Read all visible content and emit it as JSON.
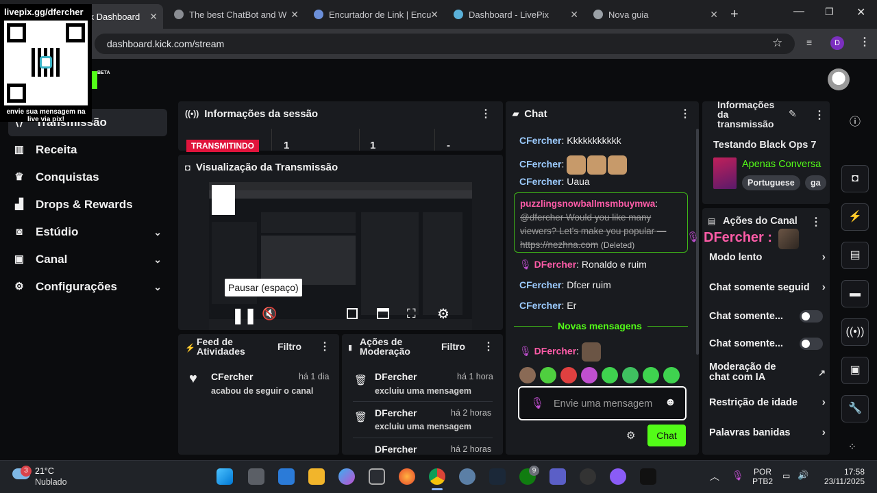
{
  "browser": {
    "tabs": [
      {
        "label": "ck Dashboard"
      },
      {
        "label": "The best ChatBot and W"
      },
      {
        "label": "Encurtador de Link | Encu"
      },
      {
        "label": "Dashboard - LivePix"
      },
      {
        "label": "Nova guia"
      }
    ],
    "url": "dashboard.kick.com/stream",
    "profile_initial": "D"
  },
  "overlay": {
    "title": "livepix.gg/dfercher",
    "caption": "envie sua mensagem na live via pix!"
  },
  "logo_badge": "BETA",
  "sidebar": {
    "items": [
      {
        "label": "Transmissão"
      },
      {
        "label": "Receita"
      },
      {
        "label": "Conquistas"
      },
      {
        "label": "Drops & Rewards"
      },
      {
        "label": "Estúdio"
      },
      {
        "label": "Canal"
      },
      {
        "label": "Configurações"
      }
    ]
  },
  "session": {
    "title": "Informações da sessão",
    "status": "TRANSMITINDO",
    "stats": [
      "1",
      "1",
      "-"
    ]
  },
  "preview": {
    "title": "Visualização da Transmissão",
    "tooltip": "Pausar (espaço)"
  },
  "activity": {
    "title": "Feed de Atividades",
    "filter": "Filtro",
    "items": [
      {
        "name": "CFercher",
        "time": "há 1 dia",
        "text": "acabou de seguir o canal"
      }
    ]
  },
  "moderation": {
    "title": "Ações de Moderação",
    "filter": "Filtro",
    "items": [
      {
        "name": "DFercher",
        "time": "há 1 hora",
        "text": "excluiu uma mensagem"
      },
      {
        "name": "DFercher",
        "time": "há 2 horas",
        "text": "excluiu uma mensagem"
      },
      {
        "name": "DFercher",
        "time": "há 2 horas",
        "text": ""
      }
    ]
  },
  "chat": {
    "title": "Chat",
    "messages": [
      {
        "user": "CFercher",
        "text": "Kkkkkkkkkkk"
      },
      {
        "user": "CFercher",
        "text": ""
      },
      {
        "user": "CFercher",
        "text": "Uaua"
      },
      {
        "user": "puzzlingsnowballmsmbuymwa",
        "text": "@dfercher Would you like many viewers? Let's make you popular — https://nezhna.com",
        "deleted": "(Deleted)"
      },
      {
        "user": "DFercher",
        "text": "Ronaldo e ruim"
      },
      {
        "user": "CFercher",
        "text": "Dfcer ruim"
      },
      {
        "user": "CFercher",
        "text": "Er"
      }
    ],
    "new_messages": "Novas mensagens",
    "last_user": "DFercher",
    "input_placeholder": "Envie uma mensagem",
    "send_label": "Chat",
    "emote_colors": [
      "#8a6a55",
      "#4fcf3f",
      "#e04040",
      "#c04fd0",
      "#3fd34f",
      "#3fc060",
      "#3fd34f",
      "#3fd34f"
    ]
  },
  "stream_info": {
    "title": "Informações da transmissão",
    "stream_title": "Testando Black Ops 7",
    "category": "Apenas Conversa",
    "tags": [
      "Portuguese",
      "ga"
    ]
  },
  "channel_actions": {
    "title": "Ações do Canal",
    "overlay_user": "DFercher",
    "rows": [
      {
        "label": "Modo lento"
      },
      {
        "label": "Chat somente seguid"
      },
      {
        "label": "Chat somente..."
      },
      {
        "label": "Chat somente..."
      },
      {
        "label": "Moderação de chat com IA"
      },
      {
        "label": "Restrição de idade"
      },
      {
        "label": "Palavras banidas"
      }
    ]
  },
  "taskbar": {
    "temp": "21°C",
    "weather": "Nublado",
    "weather_badge": "3",
    "lang1": "POR",
    "lang2": "PTB2",
    "time": "17:58",
    "date": "23/11/2025",
    "xbox_badge": "9"
  }
}
